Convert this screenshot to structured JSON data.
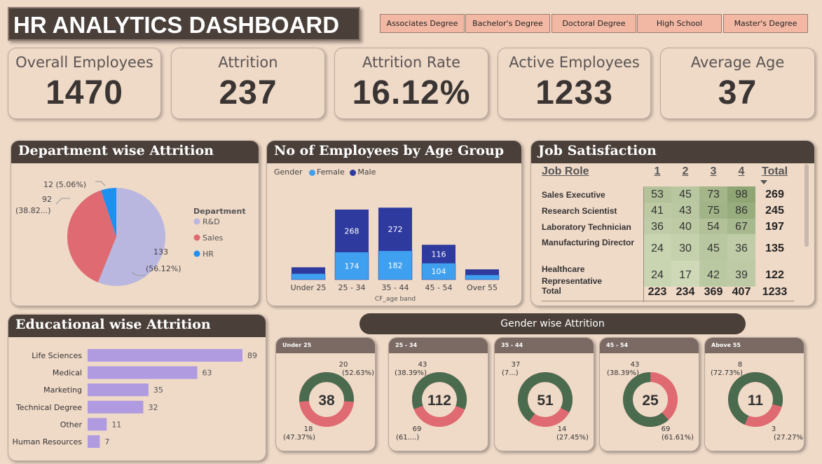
{
  "title": "HR ANALYTICS DASHBOARD",
  "filters": [
    "Associates Degree",
    "Bachelor's Degree",
    "Doctoral Degree",
    "High School",
    "Master's Degree"
  ],
  "kpis": [
    {
      "label": "Overall Employees",
      "value": "1470"
    },
    {
      "label": "Attrition",
      "value": "237"
    },
    {
      "label": "Attrition Rate",
      "value": "16.12%"
    },
    {
      "label": "Active Employees",
      "value": "1233"
    },
    {
      "label": "Average Age",
      "value": "37"
    }
  ],
  "department": {
    "title": "Department wise Attrition",
    "legend_title": "Department",
    "slices": [
      {
        "name": "R&D",
        "value": 133,
        "label": "133",
        "pct": "(56.12%)",
        "color": "#b9b6e0"
      },
      {
        "name": "Sales",
        "value": 92,
        "label": "92",
        "pct": "(38.82...)",
        "color": "#df6a72"
      },
      {
        "name": "HR",
        "value": 12,
        "label": "12 (5.06%)",
        "pct": "",
        "color": "#1e90f0"
      }
    ]
  },
  "age_group": {
    "title": "No of Employees by Age Group",
    "legend_label": "Gender",
    "female_label": "Female",
    "male_label": "Male",
    "female_color": "#3fa0f0",
    "male_color": "#2e3a9e",
    "xlabel": "CF_age band",
    "categories": [
      "Under 25",
      "25 - 34",
      "35 - 44",
      "45 - 54",
      "Over 55"
    ],
    "female": [
      38,
      174,
      182,
      104,
      30
    ],
    "male": [
      40,
      268,
      272,
      116,
      35
    ],
    "female_shown": [
      "",
      "174",
      "182",
      "104",
      ""
    ],
    "male_shown": [
      "",
      "268",
      "272",
      "116",
      ""
    ]
  },
  "job": {
    "title": "Job Satisfaction",
    "headers": [
      "Job Role",
      "1",
      "2",
      "3",
      "4",
      "Total"
    ],
    "rows": [
      {
        "role": "Sales Executive",
        "v": [
          "53",
          "45",
          "73",
          "98"
        ],
        "total": "269"
      },
      {
        "role": "Research Scientist",
        "v": [
          "41",
          "43",
          "75",
          "86"
        ],
        "total": "245"
      },
      {
        "role": "Laboratory Technician",
        "v": [
          "36",
          "40",
          "54",
          "67"
        ],
        "total": "197"
      },
      {
        "role": "Manufacturing Director",
        "v": [
          "24",
          "30",
          "45",
          "36"
        ],
        "total": "135"
      },
      {
        "role": "Healthcare Representative",
        "v": [
          "24",
          "17",
          "42",
          "39"
        ],
        "total": "122"
      }
    ],
    "total_row": {
      "role": "Total",
      "v": [
        "223",
        "234",
        "369",
        "407"
      ],
      "total": "1233"
    }
  },
  "education": {
    "title": "Educational wise Attrition",
    "bar_color": "#b09be0",
    "items": [
      {
        "name": "Life Sciences",
        "value": 89
      },
      {
        "name": "Medical",
        "value": 63
      },
      {
        "name": "Marketing",
        "value": 35
      },
      {
        "name": "Technical Degree",
        "value": 32
      },
      {
        "name": "Other",
        "value": 11
      },
      {
        "name": "Human Resources",
        "value": 7
      }
    ]
  },
  "gender": {
    "title": "Gender wise Attrition",
    "male_color": "#4b6b4f",
    "female_color": "#df6a72",
    "cards": [
      {
        "band": "Under 25",
        "total": "38",
        "male": 20,
        "female": 18,
        "label_a": "20",
        "pct_a": "(52.63%)",
        "label_b": "18",
        "pct_b": "(47.37%)"
      },
      {
        "band": "25 - 34",
        "total": "112",
        "male": 69,
        "female": 43,
        "label_a": "43",
        "pct_a": "(38.39%)",
        "label_b": "69",
        "pct_b": "(61....)"
      },
      {
        "band": "35 - 44",
        "total": "51",
        "male": 37,
        "female": 14,
        "label_a": "37",
        "pct_a": "(7...)",
        "label_b": "14",
        "pct_b": "(27.45%)"
      },
      {
        "band": "45 - 54",
        "total": "25",
        "male": 69,
        "female": 43,
        "label_a": "43",
        "pct_a": "(38.39%)",
        "label_b": "69",
        "pct_b": "(61.61%)"
      },
      {
        "band": "Above 55",
        "total": "11",
        "male": 8,
        "female": 3,
        "label_a": "8",
        "pct_a": "(72.73%)",
        "label_b": "3",
        "pct_b": "(27.27%)"
      }
    ]
  }
}
